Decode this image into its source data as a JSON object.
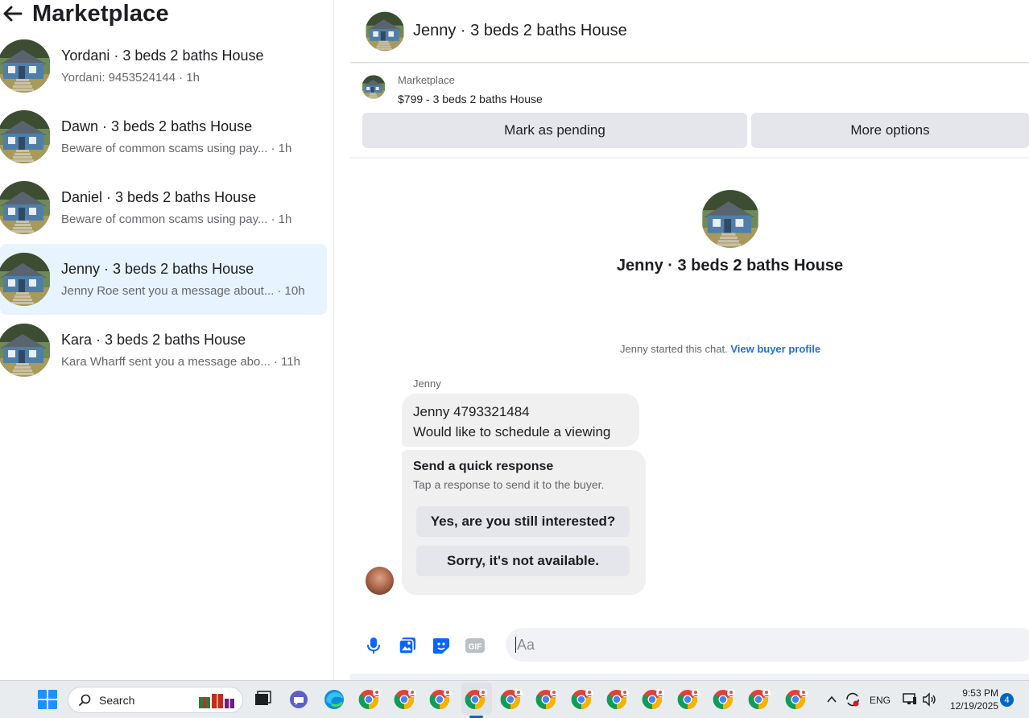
{
  "left": {
    "title": "Marketplace",
    "conversations": [
      {
        "title": "Yordani · 3 beds 2 baths House",
        "snippet": "Yordani: 9453524144",
        "time": "· 1h"
      },
      {
        "title": "Dawn · 3 beds 2 baths House",
        "snippet": "Beware of common scams using pay...",
        "time": "· 1h"
      },
      {
        "title": "Daniel · 3 beds 2 baths House",
        "snippet": "Beware of common scams using pay...",
        "time": "· 1h"
      },
      {
        "title": "Jenny · 3 beds 2 baths House",
        "snippet": "Jenny Roe sent you a message about...",
        "time": "· 10h"
      },
      {
        "title": "Kara · 3 beds 2 baths House",
        "snippet": "Kara Wharff sent you a message abo...",
        "time": "· 11h"
      }
    ]
  },
  "chat": {
    "header_title": "Jenny · 3 beds 2 baths House",
    "listing_label": "Marketplace",
    "listing_title": "$799 - 3 beds 2 baths House",
    "mark_pending": "Mark as pending",
    "more_options": "More options",
    "convo_title": "Jenny · 3 beds 2 baths House",
    "started_text": "Jenny started this chat.",
    "view_profile": "View buyer profile",
    "sender": "Jenny",
    "message_line1": "Jenny 4793321484",
    "message_line2": "Would like to schedule a viewing",
    "quick_title": "Send a quick response",
    "quick_sub": "Tap a response to send it to the buyer.",
    "quick_reply_1": "Yes, are you still interested?",
    "quick_reply_2": "Sorry, it's not available.",
    "composer_placeholder": "Aa"
  },
  "taskbar": {
    "search_placeholder": "Search",
    "language": "ENG",
    "time": "9:53 PM",
    "date": "12/19/2025",
    "notification_count": "4"
  },
  "colors": {
    "accent_blue": "#216fdb",
    "active_row": "#e7f3ff",
    "button_gray": "#e4e6eb",
    "bubble_gray": "#f0f0f0"
  }
}
